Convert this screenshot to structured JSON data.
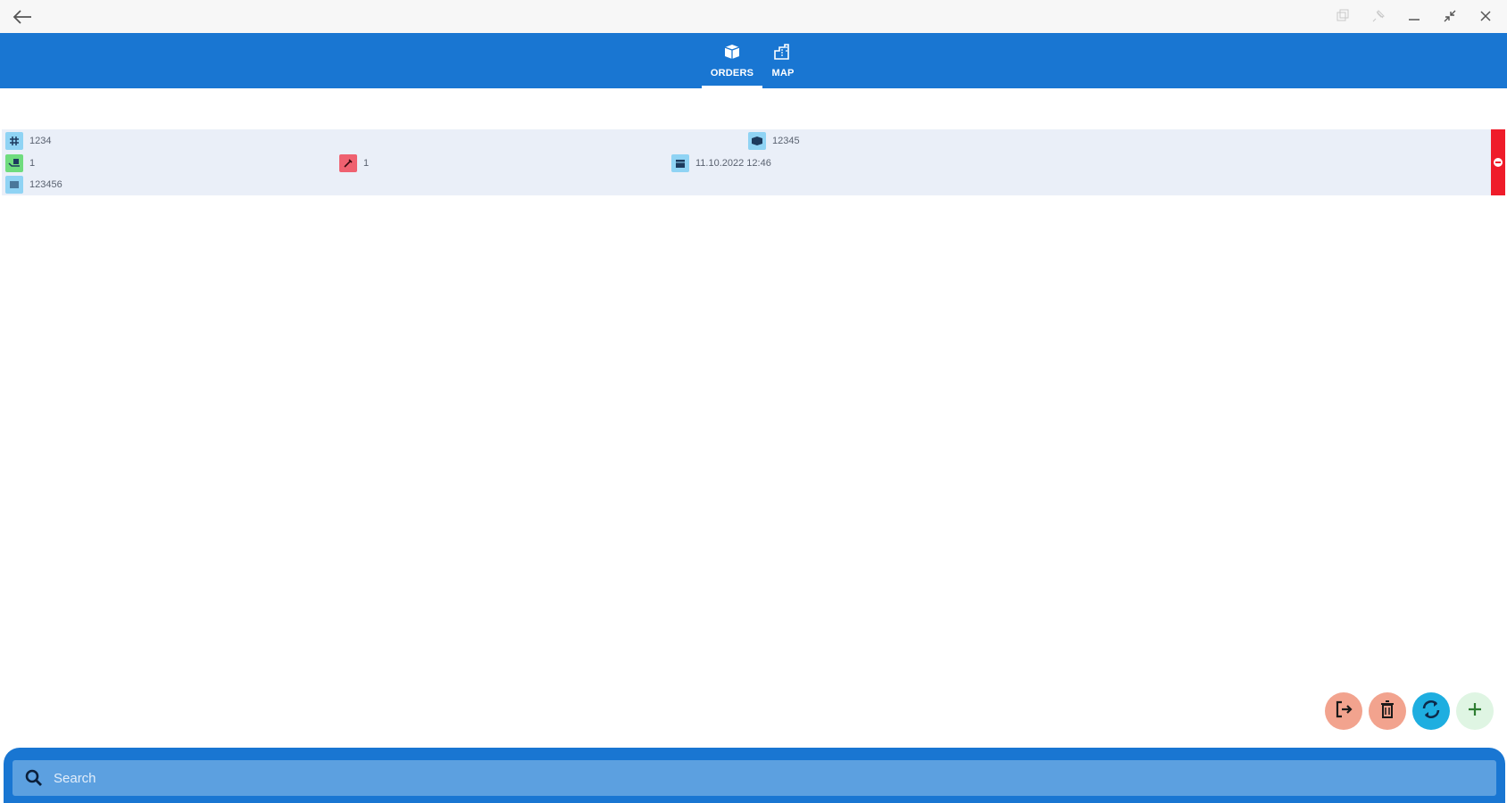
{
  "titlebar": {
    "back_icon": "arrow-left-icon",
    "controls": [
      "restore-icon",
      "pin-icon",
      "minimize-icon",
      "collapse-icon",
      "close-icon"
    ]
  },
  "tabs": [
    {
      "label": "ORDERS",
      "icon": "box-icon",
      "active": true
    },
    {
      "label": "MAP",
      "icon": "map-buildings-icon",
      "active": false
    }
  ],
  "order": {
    "number": "1234",
    "customer": "12345",
    "quantity": "1",
    "priority": "1",
    "datetime": "11.10.2022 12:46",
    "reference": "123456",
    "status_color": "#ef1c2a"
  },
  "actions": [
    {
      "name": "logout",
      "icon": "exit-icon",
      "color": "#f2a38e"
    },
    {
      "name": "delete",
      "icon": "trash-icon",
      "color": "#f2a38e"
    },
    {
      "name": "sync",
      "icon": "sync-icon",
      "color": "#1eaee0"
    },
    {
      "name": "add",
      "icon": "plus-icon",
      "color": "#dff5e3"
    }
  ],
  "search": {
    "placeholder": "Search"
  }
}
